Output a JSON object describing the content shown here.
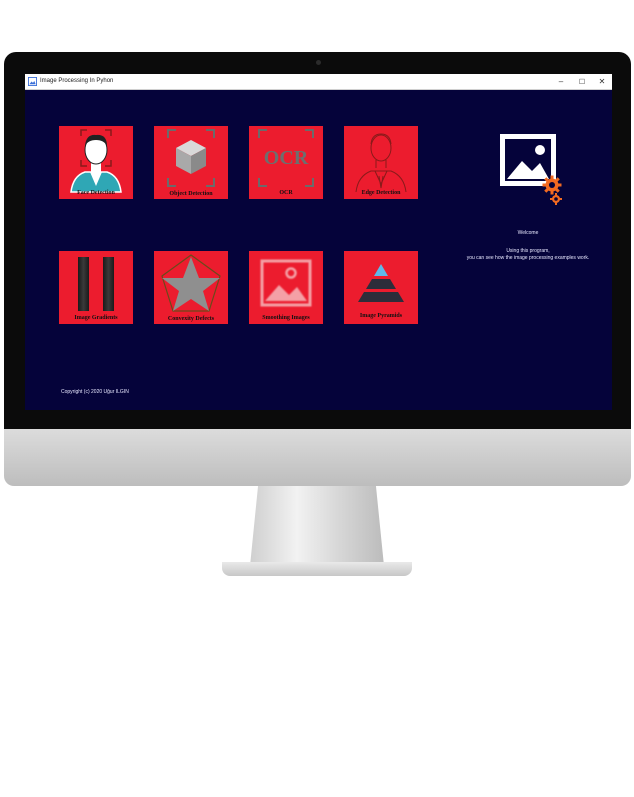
{
  "window": {
    "title": "Image Processing In Pyhon",
    "minimize": "–",
    "maximize": "☐",
    "close": "✕"
  },
  "tiles": [
    {
      "label": "Face Detection",
      "icon": "face-detection-icon"
    },
    {
      "label": "Object Detection",
      "icon": "cube-icon"
    },
    {
      "label": "OCR",
      "icon": "ocr-icon",
      "icon_text": "OCR"
    },
    {
      "label": "Edge Detection",
      "icon": "edge-face-icon"
    },
    {
      "label": "Image Gradients",
      "icon": "gradient-bars-icon"
    },
    {
      "label": "Convexity Defects",
      "icon": "star-pentagon-icon"
    },
    {
      "label": "Smoothing Images",
      "icon": "blurred-image-icon"
    },
    {
      "label": "Image Pyramids",
      "icon": "pyramid-icon"
    }
  ],
  "welcome": {
    "title": "Welcome",
    "line1": "Using this program,",
    "line2": "you can see  how the image processing examples work.",
    "icon": "image-settings-icon"
  },
  "footer": {
    "copyright": "Copyright (c) 2020 Uğur ILGIN"
  },
  "colors": {
    "tile": "#ec1c2e",
    "background": "#05033a",
    "accent_orange": "#f26a21"
  }
}
